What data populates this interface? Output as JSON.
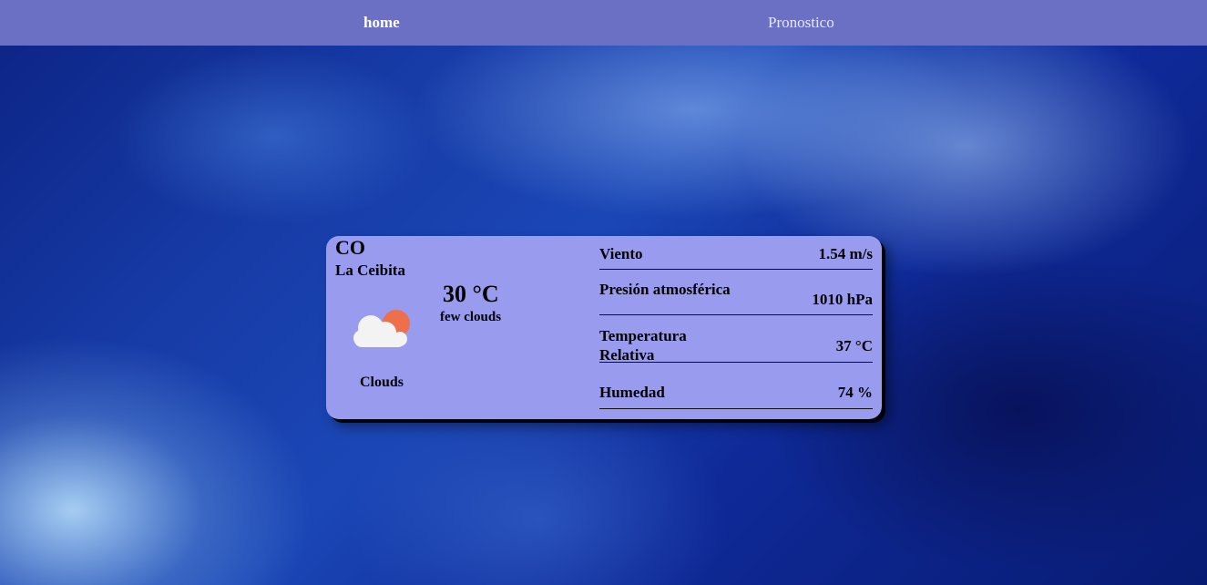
{
  "nav": {
    "home_label": "home",
    "forecast_label": "Pronostico"
  },
  "weather": {
    "country": "CO",
    "city": "La Ceibita",
    "temperature": "30 °C",
    "description": "few clouds",
    "condition": "Clouds",
    "icon": "cloud-sun-icon",
    "metrics": [
      {
        "label": "Viento",
        "value": "1.54 m/s"
      },
      {
        "label": "Presión atmosférica",
        "value": "1010 hPa"
      },
      {
        "label": "Temperatura Relativa",
        "value": "37 °C"
      },
      {
        "label": "Humedad",
        "value": "74 %"
      }
    ]
  },
  "colors": {
    "navbar": "#6b70c4",
    "card": "#999bef",
    "sun": "#ee6f4a",
    "cloud": "#f3f3f3"
  }
}
